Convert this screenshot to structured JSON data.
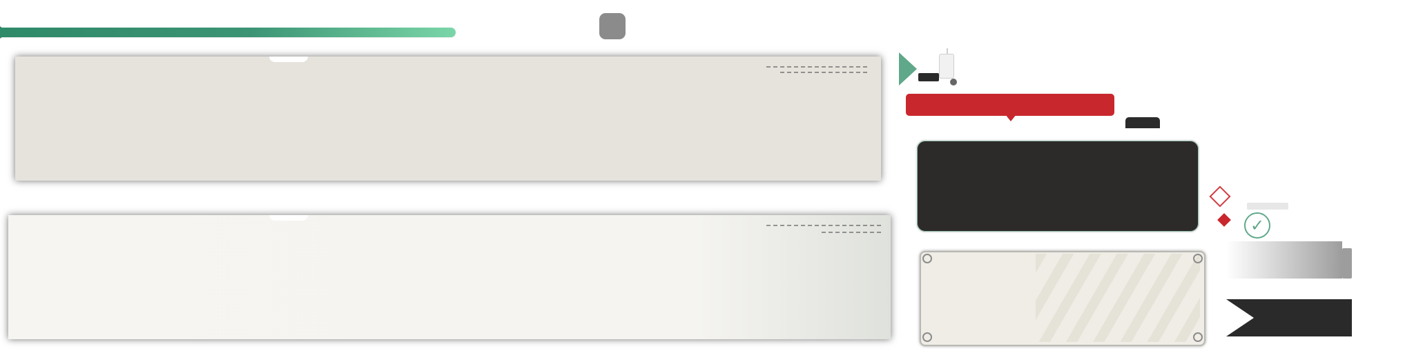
{
  "hud": {
    "progress": {
      "value_percent": 75,
      "fill_color": "#3b9474",
      "accent_color": "#7ad6a8",
      "knob_color": "#8b8b8b"
    },
    "panels": [
      {
        "name": "panel-top",
        "tone": "#e6e3dd"
      },
      {
        "name": "panel-bottom",
        "tone": "#f6f5f1"
      }
    ],
    "widgets": {
      "tooltip_color": "#c8272d",
      "dark_card_color": "#2d2a2a",
      "light_card_color": "#efede6",
      "check_icon": "check-circle-icon",
      "check_glyph": "✓",
      "ribbon_color": "#2a2a2a"
    }
  }
}
